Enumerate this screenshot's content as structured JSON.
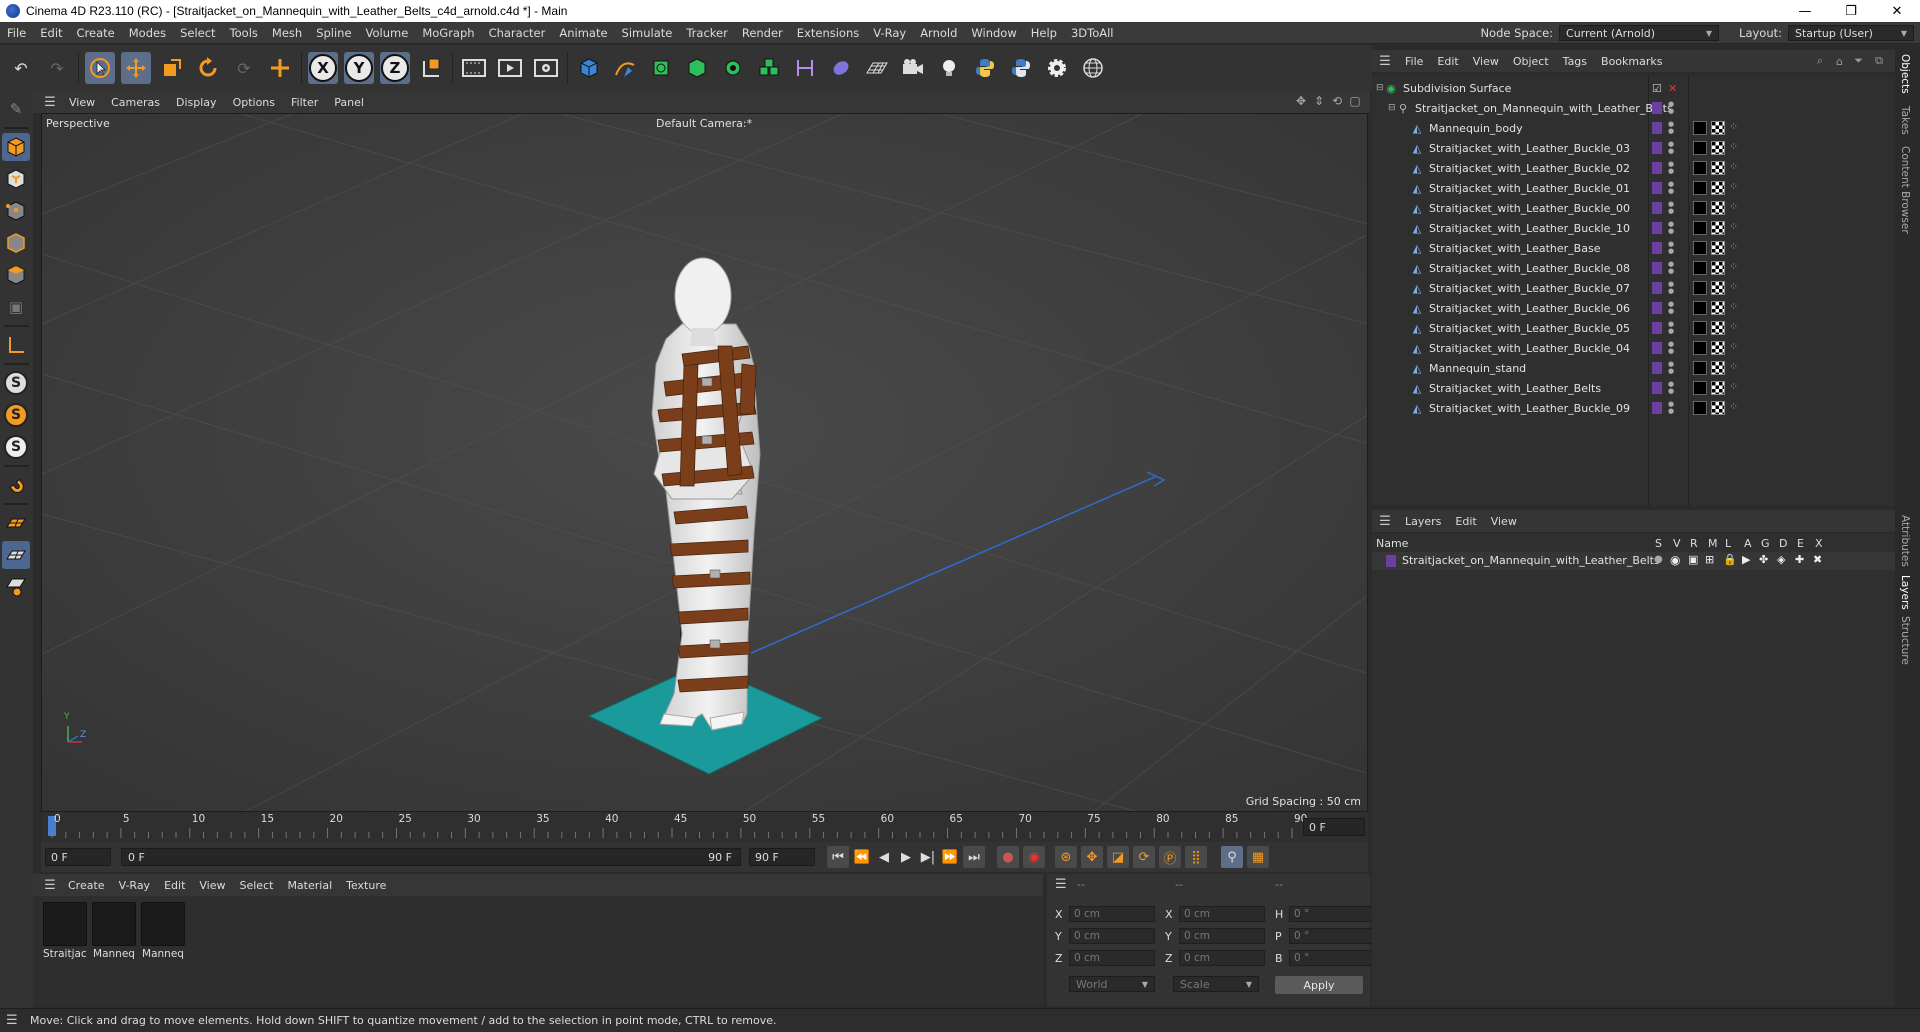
{
  "window": {
    "title": "Cinema 4D R23.110 (RC) - [Straitjacket_on_Mannequin_with_Leather_Belts_c4d_arnold.c4d *] - Main",
    "controls": [
      "—",
      "❐",
      "✕"
    ]
  },
  "menubar": {
    "items": [
      "File",
      "Edit",
      "Create",
      "Modes",
      "Select",
      "Tools",
      "Mesh",
      "Spline",
      "Volume",
      "MoGraph",
      "Character",
      "Animate",
      "Simulate",
      "Tracker",
      "Render",
      "Extensions",
      "V-Ray",
      "Arnold",
      "Window",
      "Help",
      "3DToAll"
    ],
    "node_space_label": "Node Space:",
    "node_space_value": "Current (Arnold)",
    "layout_label": "Layout:",
    "layout_value": "Startup (User)"
  },
  "toolbar": {
    "axes": [
      "X",
      "Y",
      "Z"
    ]
  },
  "viewport": {
    "menu": [
      "View",
      "Cameras",
      "Display",
      "Options",
      "Filter",
      "Panel"
    ],
    "projection": "Perspective",
    "camera": "Default Camera",
    "camera_suffix": ":*",
    "grid_spacing": "Grid Spacing : 50 cm",
    "axis_labels": [
      "Y",
      "Z"
    ]
  },
  "timeline": {
    "ticks": [
      "0",
      "5",
      "10",
      "15",
      "20",
      "25",
      "30",
      "35",
      "40",
      "45",
      "50",
      "55",
      "60",
      "65",
      "70",
      "75",
      "80",
      "85",
      "90"
    ],
    "current_frame_right": "0 F",
    "start_field": "0 F",
    "range_start": "0 F",
    "range_end": "90 F",
    "end_field": "90 F"
  },
  "materials": {
    "menu": [
      "Create",
      "V-Ray",
      "Edit",
      "View",
      "Select",
      "Material",
      "Texture"
    ],
    "items": [
      "Straitjack",
      "Manneq",
      "Manneq"
    ]
  },
  "coordinates": {
    "header_dashes": [
      "--",
      "--",
      "--"
    ],
    "rows": [
      {
        "a": "X",
        "a_val": "0 cm",
        "b": "X",
        "b_val": "0 cm",
        "c": "H",
        "c_val": "0 °"
      },
      {
        "a": "Y",
        "a_val": "0 cm",
        "b": "Y",
        "b_val": "0 cm",
        "c": "P",
        "c_val": "0 °"
      },
      {
        "a": "Z",
        "a_val": "0 cm",
        "b": "Z",
        "b_val": "0 cm",
        "c": "B",
        "c_val": "0 °"
      }
    ],
    "space": "World",
    "mode": "Scale",
    "apply": "Apply"
  },
  "status": {
    "message": "Move: Click and drag to move elements. Hold down SHIFT to quantize movement / add to the selection in point mode, CTRL to remove."
  },
  "object_manager": {
    "menu": [
      "File",
      "Edit",
      "View",
      "Object",
      "Tags",
      "Bookmarks"
    ],
    "root": "Subdivision Surface",
    "group": "Straitjacket_on_Mannequin_with_Leather_Belts",
    "children": [
      "Mannequin_body",
      "Straitjacket_with_Leather_Buckle_03",
      "Straitjacket_with_Leather_Buckle_02",
      "Straitjacket_with_Leather_Buckle_01",
      "Straitjacket_with_Leather_Buckle_00",
      "Straitjacket_with_Leather_Buckle_10",
      "Straitjacket_with_Leather_Base",
      "Straitjacket_with_Leather_Buckle_08",
      "Straitjacket_with_Leather_Buckle_07",
      "Straitjacket_with_Leather_Buckle_06",
      "Straitjacket_with_Leather_Buckle_05",
      "Straitjacket_with_Leather_Buckle_04",
      "Mannequin_stand",
      "Straitjacket_with_Leather_Belts",
      "Straitjacket_with_Leather_Buckle_09"
    ]
  },
  "layers": {
    "menu": [
      "Layers",
      "Edit",
      "View"
    ],
    "columns": [
      "Name",
      "S",
      "V",
      "R",
      "M",
      "L",
      "A",
      "G",
      "D",
      "E",
      "X"
    ],
    "rows": [
      "Straitjacket_on_Mannequin_with_Leather_Belts"
    ]
  },
  "side_tabs": [
    "Objects",
    "Takes",
    "Content Browser",
    "Attributes",
    "Layers",
    "Structure"
  ],
  "colors": {
    "accent": "#5c6e8a",
    "ground_plane": "#1a9a9a",
    "belt": "#7a3f1a",
    "layer_color": "#6b3fa0",
    "tag_orange": "#f0903a"
  }
}
